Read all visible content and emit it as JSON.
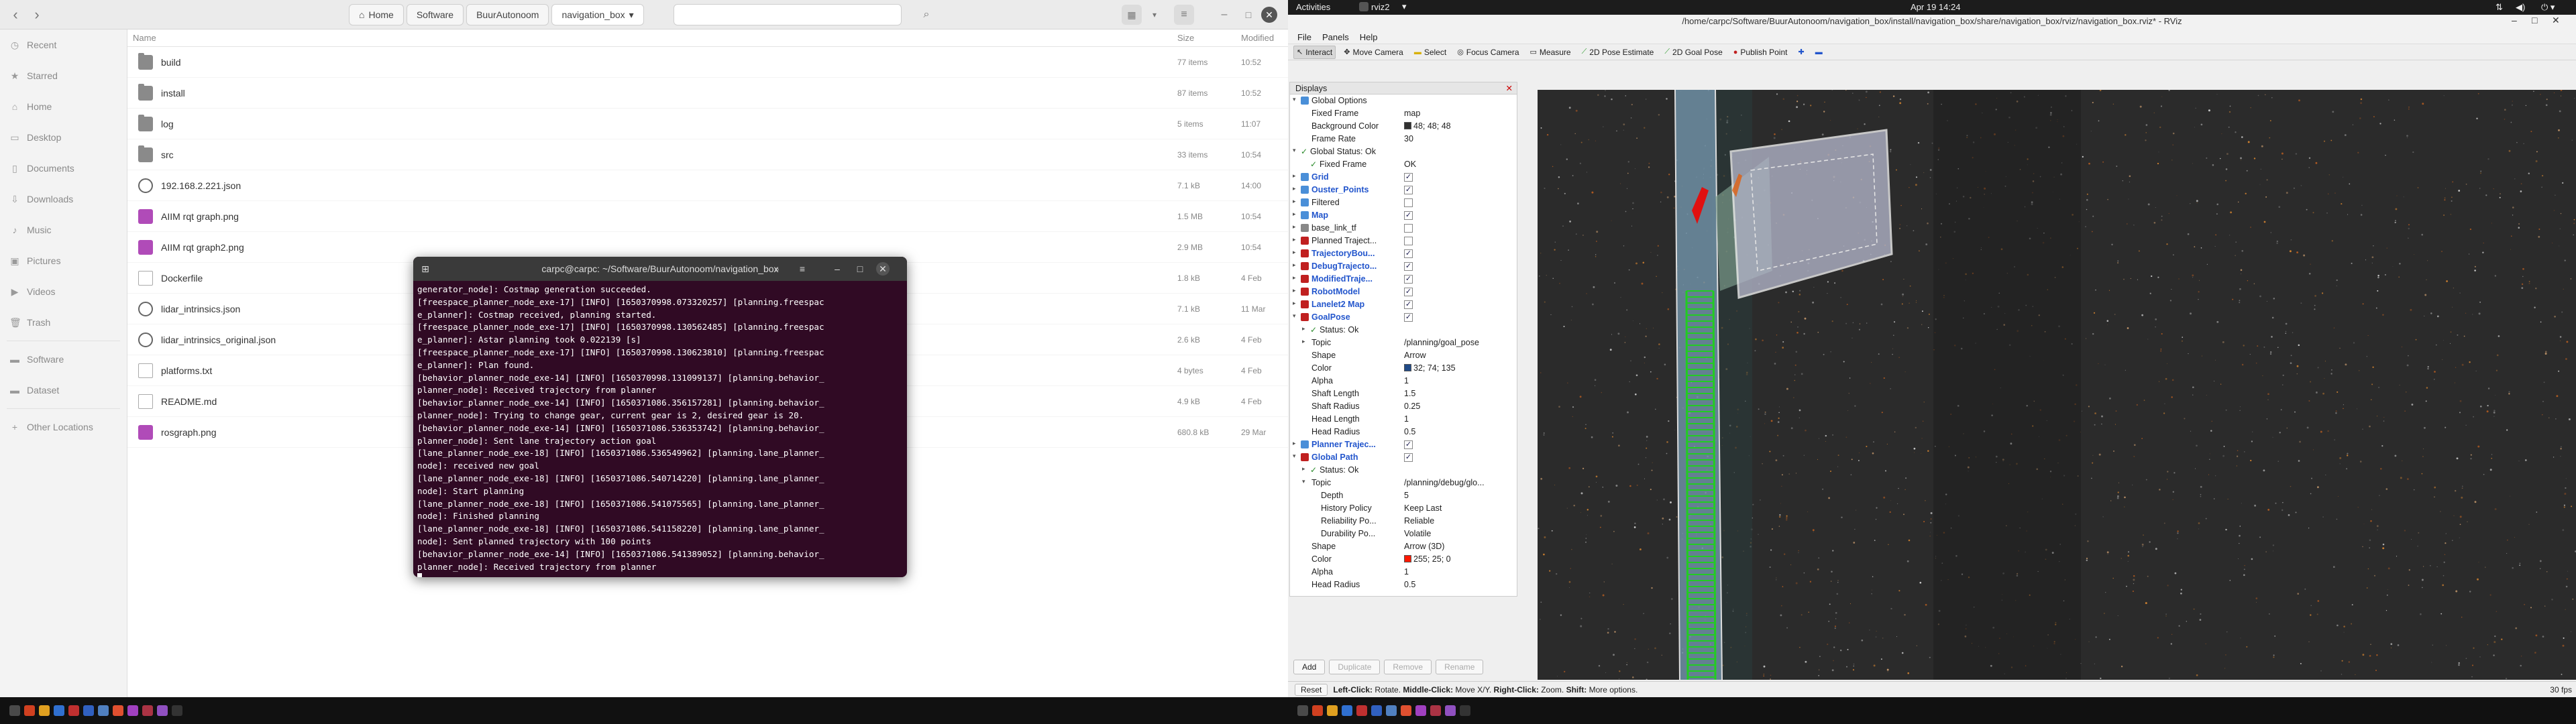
{
  "files": {
    "breadcrumbs": [
      "Home",
      "Software",
      "BuurAutonoom",
      "navigation_box"
    ],
    "sidebar": [
      {
        "label": "Recent",
        "icon": "clock-icon"
      },
      {
        "label": "Starred",
        "icon": "star-icon"
      },
      {
        "label": "Home",
        "icon": "home-icon"
      },
      {
        "label": "Desktop",
        "icon": "desktop-icon"
      },
      {
        "label": "Documents",
        "icon": "document-icon"
      },
      {
        "label": "Downloads",
        "icon": "download-icon"
      },
      {
        "label": "Music",
        "icon": "music-icon"
      },
      {
        "label": "Pictures",
        "icon": "picture-icon"
      },
      {
        "label": "Videos",
        "icon": "video-icon"
      },
      {
        "label": "Trash",
        "icon": "trash-icon"
      },
      {
        "label": "Software",
        "icon": "folder-icon"
      },
      {
        "label": "Dataset",
        "icon": "folder-icon"
      },
      {
        "label": "Other Locations",
        "icon": "plus-icon"
      }
    ],
    "columns": {
      "name": "Name",
      "size": "Size",
      "modified": "Modified"
    },
    "rows": [
      {
        "name": "build",
        "size": "77 items",
        "modified": "10:52",
        "kind": "folder"
      },
      {
        "name": "install",
        "size": "87 items",
        "modified": "10:52",
        "kind": "folder"
      },
      {
        "name": "log",
        "size": "5 items",
        "modified": "11:07",
        "kind": "folder"
      },
      {
        "name": "src",
        "size": "33 items",
        "modified": "10:54",
        "kind": "folder"
      },
      {
        "name": "192.168.2.221.json",
        "size": "7.1 kB",
        "modified": "14:00",
        "kind": "json"
      },
      {
        "name": "AIIM rqt graph.png",
        "size": "1.5 MB",
        "modified": "10:54",
        "kind": "image"
      },
      {
        "name": "AIIM rqt graph2.png",
        "size": "2.9 MB",
        "modified": "10:54",
        "kind": "image"
      },
      {
        "name": "Dockerfile",
        "size": "1.8 kB",
        "modified": "4 Feb",
        "kind": "text"
      },
      {
        "name": "lidar_intrinsics.json",
        "size": "7.1 kB",
        "modified": "11 Mar",
        "kind": "json"
      },
      {
        "name": "lidar_intrinsics_original.json",
        "size": "2.6 kB",
        "modified": "4 Feb",
        "kind": "json"
      },
      {
        "name": "platforms.txt",
        "size": "4 bytes",
        "modified": "4 Feb",
        "kind": "text"
      },
      {
        "name": "README.md",
        "size": "4.9 kB",
        "modified": "4 Feb",
        "kind": "text"
      },
      {
        "name": "rosgraph.png",
        "size": "680.8 kB",
        "modified": "29 Mar",
        "kind": "image"
      }
    ]
  },
  "terminal": {
    "title": "carpc@carpc: ~/Software/BuurAutonoom/navigation_box",
    "lines": [
      "generator_node]: Costmap generation succeeded.",
      "[freespace_planner_node_exe-17] [INFO] [1650370998.073320257] [planning.freespac",
      "e_planner]: Costmap received, planning started.",
      "[freespace_planner_node_exe-17] [INFO] [1650370998.130562485] [planning.freespac",
      "e_planner]: Astar planning took 0.022139 [s]",
      "[freespace_planner_node_exe-17] [INFO] [1650370998.130623810] [planning.freespac",
      "e_planner]: Plan found.",
      "[behavior_planner_node_exe-14] [INFO] [1650370998.131099137] [planning.behavior_",
      "planner_node]: Received trajectory from planner",
      "[behavior_planner_node_exe-14] [INFO] [1650371086.356157281] [planning.behavior_",
      "planner_node]: Trying to change gear, current gear is 2, desired gear is 20.",
      "[behavior_planner_node_exe-14] [INFO] [1650371086.536353742] [planning.behavior_",
      "planner_node]: Sent lane trajectory action goal",
      "[lane_planner_node_exe-18] [INFO] [1650371086.536549962] [planning.lane_planner_",
      "node]: received new goal",
      "[lane_planner_node_exe-18] [INFO] [1650371086.540714220] [planning.lane_planner_",
      "node]: Start planning",
      "[lane_planner_node_exe-18] [INFO] [1650371086.541075565] [planning.lane_planner_",
      "node]: Finished planning",
      "[lane_planner_node_exe-18] [INFO] [1650371086.541158220] [planning.lane_planner_",
      "node]: Sent planned trajectory with 100 points",
      "[behavior_planner_node_exe-14] [INFO] [1650371086.541389052] [planning.behavior_",
      "planner_node]: Received trajectory from planner"
    ]
  },
  "topbar": {
    "activities": "Activities",
    "app": "rviz2",
    "clock": "Apr 19  14:24"
  },
  "rviz": {
    "title": "/home/carpc/Software/BuurAutonoom/navigation_box/install/navigation_box/share/navigation_box/rviz/navigation_box.rviz* - RViz",
    "menu": [
      "File",
      "Panels",
      "Help"
    ],
    "tools": [
      "Interact",
      "Move Camera",
      "Select",
      "Focus Camera",
      "Measure",
      "2D Pose Estimate",
      "2D Goal Pose",
      "Publish Point"
    ],
    "displays_header": "Displays",
    "tree": [
      {
        "label": "Global Options",
        "indent": 0,
        "arrow": "▾",
        "icon": "#4a8fd8"
      },
      {
        "label": "Fixed Frame",
        "indent": 1,
        "value": "map"
      },
      {
        "label": "Background Color",
        "indent": 1,
        "value": "48; 48; 48",
        "swatch": "#303030"
      },
      {
        "label": "Frame Rate",
        "indent": 1,
        "value": "30"
      },
      {
        "label": "Global Status: Ok",
        "indent": 0,
        "arrow": "▾",
        "check": true
      },
      {
        "label": "Fixed Frame",
        "indent": 1,
        "value": "OK",
        "check": true
      },
      {
        "label": "Grid",
        "indent": 0,
        "arrow": "▸",
        "icon": "#4a8fd8",
        "blue": true,
        "cb": "✓"
      },
      {
        "label": "Ouster_Points",
        "indent": 0,
        "arrow": "▸",
        "icon": "#4a8fd8",
        "blue": true,
        "cb": "✓"
      },
      {
        "label": "Filtered",
        "indent": 0,
        "arrow": "▸",
        "icon": "#4a8fd8",
        "cb": ""
      },
      {
        "label": "Map",
        "indent": 0,
        "arrow": "▸",
        "icon": "#4a8fd8",
        "blue": true,
        "cb": "✓"
      },
      {
        "label": "base_link_tf",
        "indent": 0,
        "arrow": "▸",
        "icon": "#888888",
        "cb": ""
      },
      {
        "label": "Planned Traject...",
        "indent": 0,
        "arrow": "▸",
        "icon": "#c02020",
        "cb": ""
      },
      {
        "label": "TrajectoryBou...",
        "indent": 0,
        "arrow": "▸",
        "icon": "#c02020",
        "blue": true,
        "cb": "✓"
      },
      {
        "label": "DebugTrajecto...",
        "indent": 0,
        "arrow": "▸",
        "icon": "#c02020",
        "blue": true,
        "cb": "✓"
      },
      {
        "label": "ModifiedTraje...",
        "indent": 0,
        "arrow": "▸",
        "icon": "#c02020",
        "blue": true,
        "cb": "✓"
      },
      {
        "label": "RobotModel",
        "indent": 0,
        "arrow": "▸",
        "icon": "#c02020",
        "blue": true,
        "cb": "✓"
      },
      {
        "label": "Lanelet2 Map",
        "indent": 0,
        "arrow": "▸",
        "icon": "#c02020",
        "blue": true,
        "cb": "✓"
      },
      {
        "label": "GoalPose",
        "indent": 0,
        "arrow": "▾",
        "icon": "#c02020",
        "blue": true,
        "cb": "✓"
      },
      {
        "label": "Status: Ok",
        "indent": 1,
        "arrow": "▸",
        "check": true
      },
      {
        "label": "Topic",
        "indent": 1,
        "arrow": "▸",
        "value": "/planning/goal_pose"
      },
      {
        "label": "Shape",
        "indent": 1,
        "value": "Arrow"
      },
      {
        "label": "Color",
        "indent": 1,
        "value": "32; 74; 135",
        "swatch": "#204a87"
      },
      {
        "label": "Alpha",
        "indent": 1,
        "value": "1"
      },
      {
        "label": "Shaft Length",
        "indent": 1,
        "value": "1.5"
      },
      {
        "label": "Shaft Radius",
        "indent": 1,
        "value": "0.25"
      },
      {
        "label": "Head Length",
        "indent": 1,
        "value": "1"
      },
      {
        "label": "Head Radius",
        "indent": 1,
        "value": "0.5"
      },
      {
        "label": "Planner Trajec...",
        "indent": 0,
        "arrow": "▸",
        "icon": "#4a8fd8",
        "blue": true,
        "cb": "✓"
      },
      {
        "label": "Global Path",
        "indent": 0,
        "arrow": "▾",
        "icon": "#c02020",
        "blue": true,
        "cb": "✓"
      },
      {
        "label": "Status: Ok",
        "indent": 1,
        "arrow": "▸",
        "check": true
      },
      {
        "label": "Topic",
        "indent": 1,
        "arrow": "▾",
        "value": "/planning/debug/glo..."
      },
      {
        "label": "Depth",
        "indent": 2,
        "value": "5"
      },
      {
        "label": "History Policy",
        "indent": 2,
        "value": "Keep Last"
      },
      {
        "label": "Reliability Po...",
        "indent": 2,
        "value": "Reliable"
      },
      {
        "label": "Durability Po...",
        "indent": 2,
        "value": "Volatile"
      },
      {
        "label": "Shape",
        "indent": 1,
        "value": "Arrow (3D)"
      },
      {
        "label": "Color",
        "indent": 1,
        "value": "255; 25; 0",
        "swatch": "#ff1900"
      },
      {
        "label": "Alpha",
        "indent": 1,
        "value": "1"
      },
      {
        "label": "Head Radius",
        "indent": 1,
        "value": "0.5"
      }
    ],
    "panel_buttons": [
      "Add",
      "Duplicate",
      "Remove",
      "Rename"
    ],
    "status": {
      "reset": "Reset",
      "hint_bold": "Left-Click:",
      "hint1": " Rotate. ",
      "hint2_bold": "Middle-Click:",
      "hint2": " Move X/Y. ",
      "hint3_bold": "Right-Click:",
      "hint3": " Zoom. ",
      "hint4_bold": "Shift:",
      "hint4": " More options.",
      "fps": "30 fps"
    }
  }
}
